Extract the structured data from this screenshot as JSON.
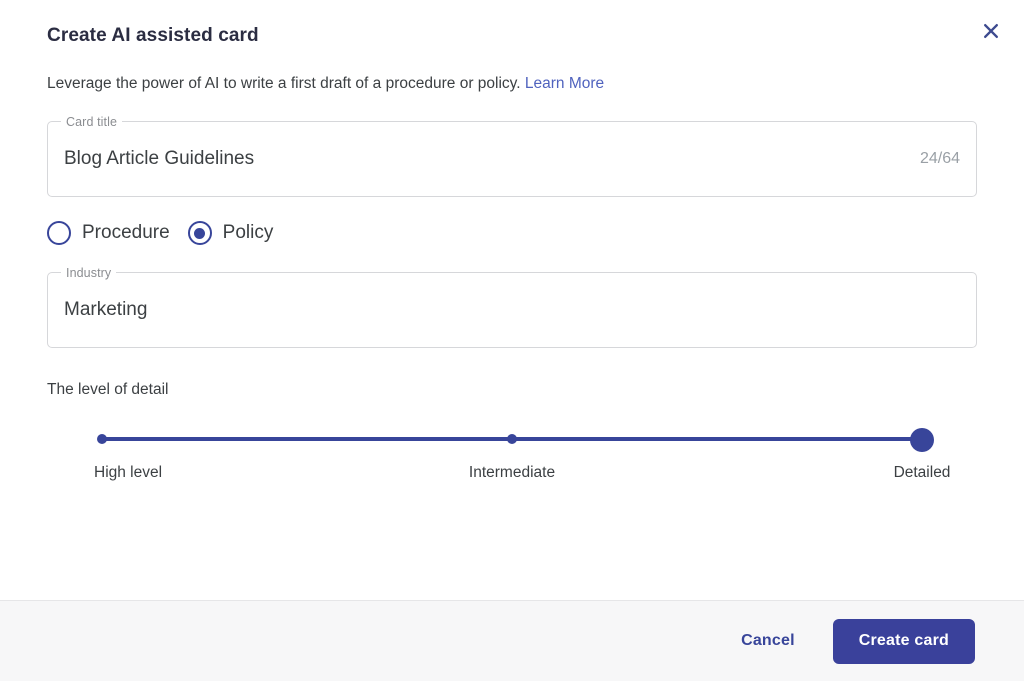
{
  "dialog": {
    "title": "Create AI assisted card",
    "subtitle_text": "Leverage the power of AI to write a first draft of a procedure or policy.",
    "learn_more_label": "Learn More",
    "close_icon": "close-icon"
  },
  "card_title_field": {
    "legend": "Card title",
    "value": "Blog Article Guidelines",
    "placeholder": "Card title",
    "counter": "24/64"
  },
  "card_type": {
    "options": [
      {
        "label": "Procedure",
        "selected": false
      },
      {
        "label": "Policy",
        "selected": true
      }
    ]
  },
  "industry_field": {
    "legend": "Industry",
    "value": "Marketing",
    "placeholder": "Industry"
  },
  "detail_slider": {
    "heading": "The level of detail",
    "ticks": [
      {
        "label": "High level",
        "position_pct": 0
      },
      {
        "label": "Intermediate",
        "position_pct": 50
      },
      {
        "label": "Detailed",
        "position_pct": 100
      }
    ],
    "selected_label": "Detailed",
    "selected_position_pct": 100
  },
  "footer": {
    "cancel_label": "Cancel",
    "create_label": "Create card"
  },
  "colors": {
    "accent": "#38459a",
    "primary_button": "#3a419b",
    "link": "#5063be",
    "footer_bg": "#f7f7f8",
    "field_border": "#d6d7da"
  }
}
